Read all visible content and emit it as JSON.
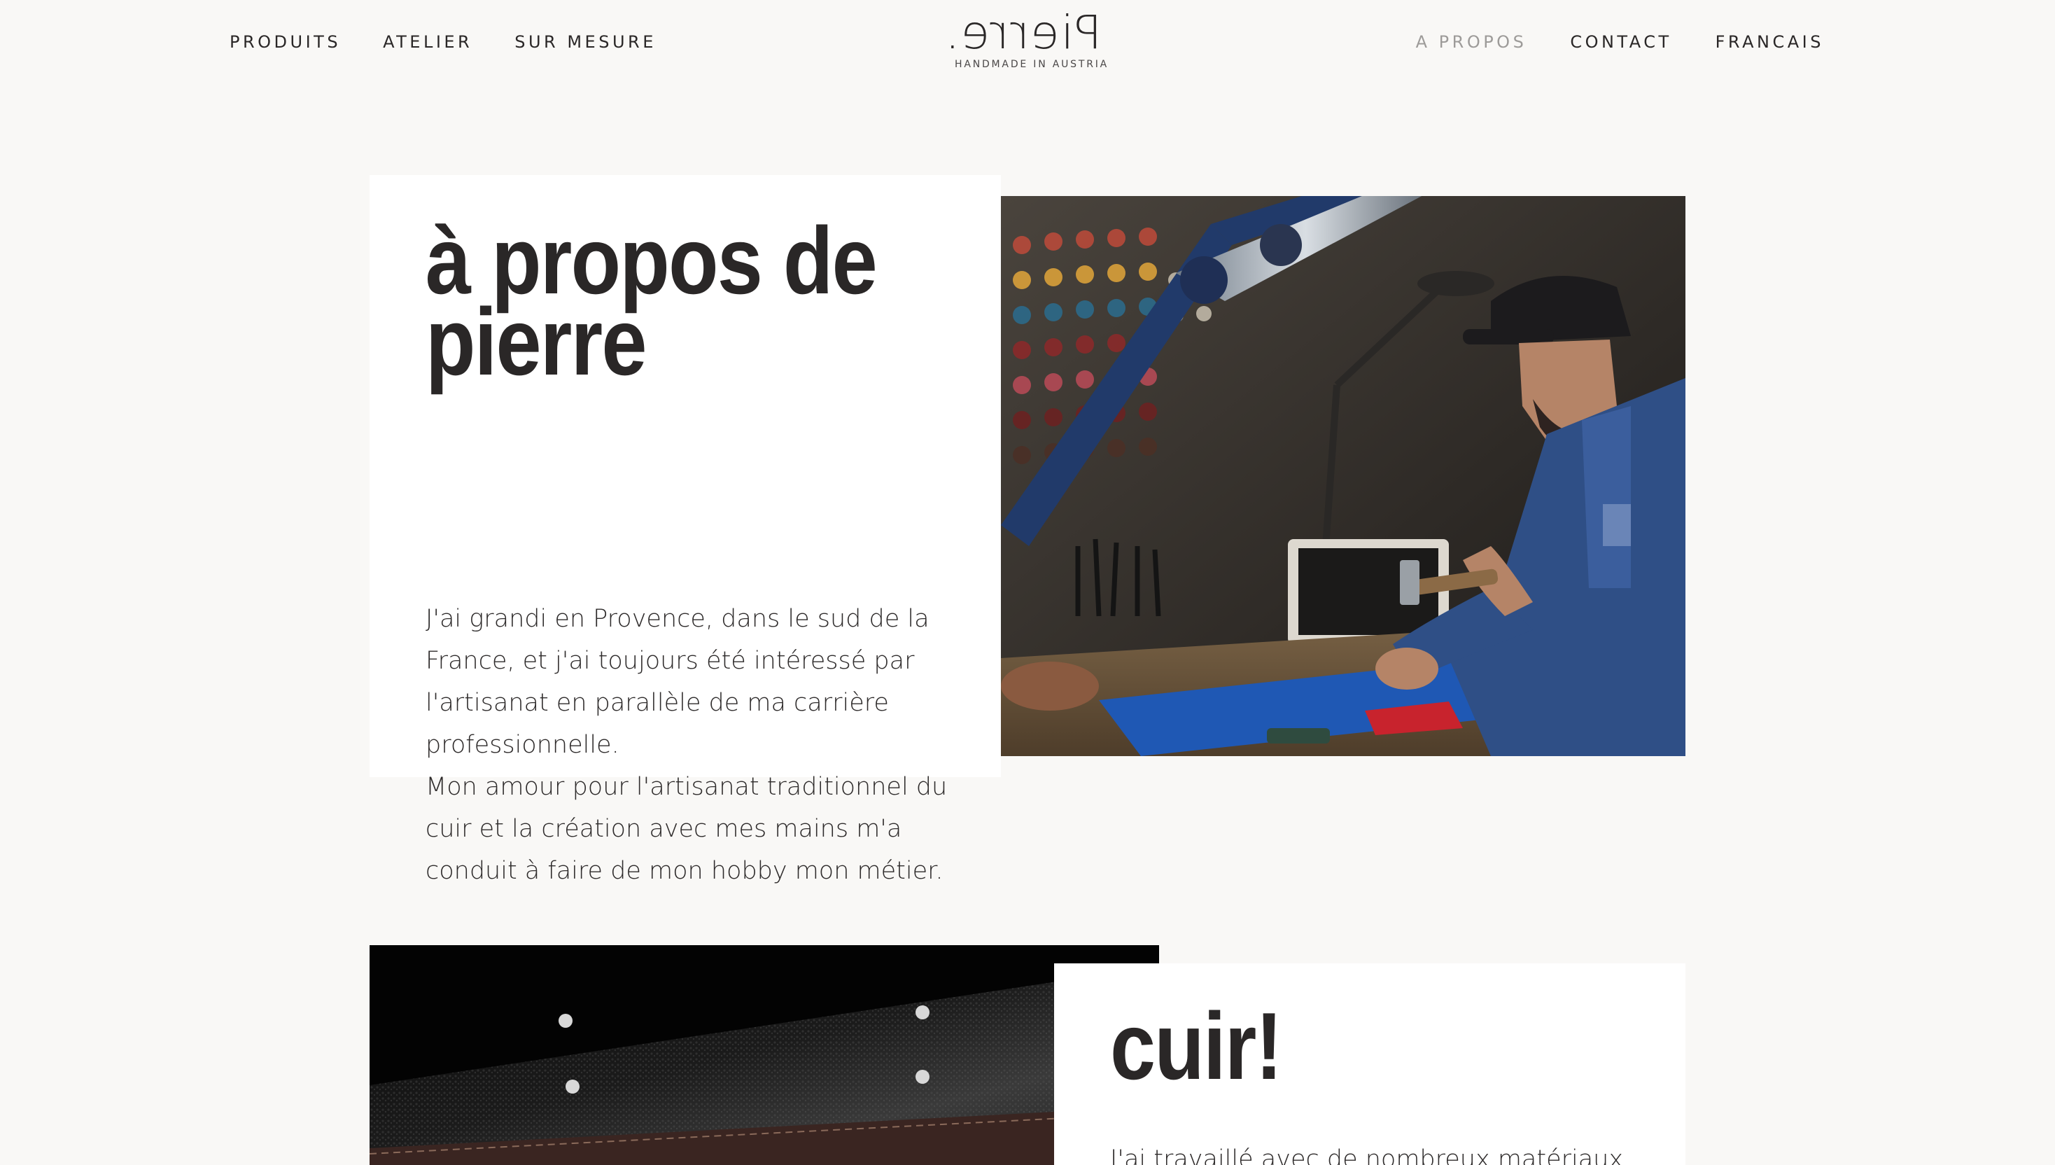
{
  "nav": {
    "left": [
      "PRODUITS",
      "ATELIER",
      "SUR MESURE"
    ],
    "right": [
      "A PROPOS",
      "CONTACT",
      "FRANCAIS"
    ],
    "active": "A PROPOS"
  },
  "logo": {
    "wordmark": "Pierre.",
    "tagline": "HANDMADE IN AUSTRIA"
  },
  "about": {
    "heading_line1": "à propos de",
    "heading_line2": "pierre",
    "paragraph1": "J'ai grandi en Provence, dans le sud de la France, et j'ai toujours été intéressé par l'artisanat en parallèle de ma carrière professionnelle.",
    "paragraph2": "Mon amour pour l'artisanat traditionnel du cuir et la création avec mes mains m'a conduit à faire de mon hobby mon métier."
  },
  "cuir": {
    "heading": "cuir!",
    "paragraph": "J'ai travaillé avec de nombreux matériaux"
  },
  "colors": {
    "background": "#f9f8f6",
    "text": "#2a2727",
    "active_nav": "#9d9b99",
    "workshop_blue": "#2f4f86",
    "mat_blue": "#1f58b4",
    "leather_red": "#c8232d"
  }
}
